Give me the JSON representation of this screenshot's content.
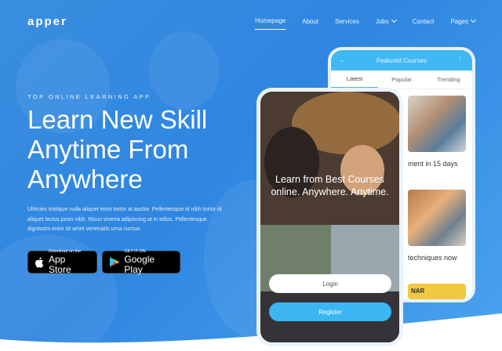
{
  "brand": "apper",
  "nav": [
    {
      "label": "Homepage",
      "active": true,
      "dropdown": false
    },
    {
      "label": "About",
      "active": false,
      "dropdown": false
    },
    {
      "label": "Services",
      "active": false,
      "dropdown": false
    },
    {
      "label": "Jobs",
      "active": false,
      "dropdown": true
    },
    {
      "label": "Contact",
      "active": false,
      "dropdown": false
    },
    {
      "label": "Pages",
      "active": false,
      "dropdown": true
    }
  ],
  "hero": {
    "eyebrow": "TOP ONLINE LEARNING APP",
    "headline": "Learn New Skill Anytime From Anywhere",
    "description": "Ultricies tristique nulla aliquet enim tortor at auctor. Pellentesque id nibh tortor id aliquet lectus proin nibh. Risus viverra adipiscing at in tellus. Pellentesque dignissim enim sit amet venenatis urna cursus.",
    "app_store": {
      "small": "Download on the",
      "big": "App Store"
    },
    "google_play": {
      "small": "GET IT ON",
      "big": "Google Play"
    }
  },
  "phone_back": {
    "title": "Featured Courses",
    "tabs": [
      "Latest",
      "Popular",
      "Trending"
    ],
    "courses": [
      "ment in 15 days",
      "techniques now"
    ],
    "banner_text": "NAR"
  },
  "phone_front": {
    "tagline": "Learn from Best Courses online. Anywhere. Anytime.",
    "login_label": "Login",
    "register_label": "Register"
  },
  "colors": {
    "accent": "#3cb6f3",
    "background": "#2f86e0"
  }
}
